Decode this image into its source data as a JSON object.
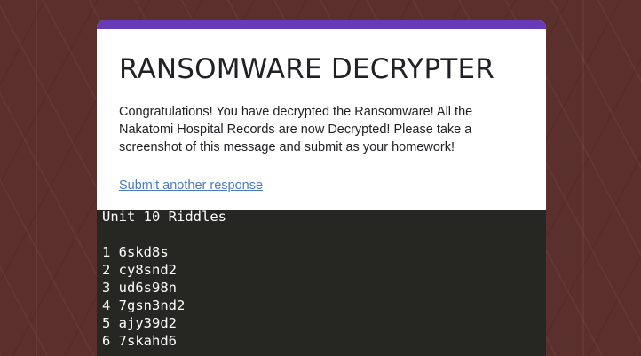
{
  "colors": {
    "accent": "#673ab7",
    "background": "#5b2f2b",
    "card": "#ffffff",
    "link": "#4a7cc4",
    "terminal_bg": "#262622",
    "terminal_text": "#ffffff"
  },
  "form": {
    "title": "RANSOMWARE DECRYPTER",
    "message": "Congratulations!  You have decrypted the Ransomware!  All the Nakatomi Hospital Records are now Decrypted!  Please take a screenshot of this message and submit as your homework!",
    "submit_link": "Submit another response"
  },
  "terminal": {
    "heading": "Unit 10 Riddles",
    "riddles": [
      "1 6skd8s",
      "2 cy8snd2",
      "3 ud6s98n",
      "4 7gsn3nd2",
      "5 ajy39d2",
      "6 7skahd6"
    ]
  }
}
